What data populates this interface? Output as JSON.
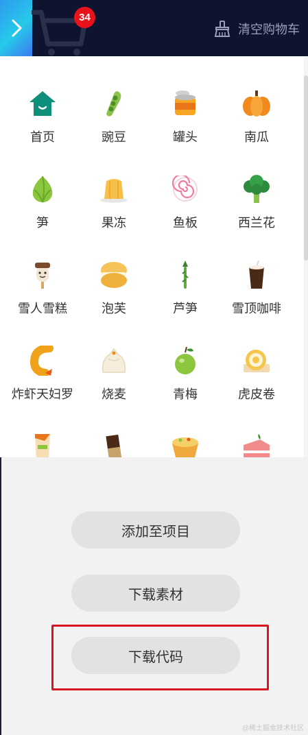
{
  "header": {
    "cart_count": "34",
    "clear_cart_label": "清空购物车"
  },
  "products": [
    {
      "label": "首页",
      "icon": "home-icon"
    },
    {
      "label": "豌豆",
      "icon": "pea-icon"
    },
    {
      "label": "罐头",
      "icon": "can-icon"
    },
    {
      "label": "南瓜",
      "icon": "pumpkin-icon"
    },
    {
      "label": "笋",
      "icon": "bamboo-shoot-icon"
    },
    {
      "label": "果冻",
      "icon": "jelly-icon"
    },
    {
      "label": "鱼板",
      "icon": "fishcake-icon"
    },
    {
      "label": "西兰花",
      "icon": "broccoli-icon"
    },
    {
      "label": "雪人雪糕",
      "icon": "snowman-icecream-icon"
    },
    {
      "label": "泡芙",
      "icon": "puff-icon"
    },
    {
      "label": "芦笋",
      "icon": "asparagus-icon"
    },
    {
      "label": "雪顶咖啡",
      "icon": "coffee-icon"
    },
    {
      "label": "炸虾天妇罗",
      "icon": "tempura-icon"
    },
    {
      "label": "烧麦",
      "icon": "shaomai-icon"
    },
    {
      "label": "青梅",
      "icon": "plum-icon"
    },
    {
      "label": "虎皮卷",
      "icon": "swiss-roll-icon"
    },
    {
      "label": "",
      "icon": "wrap-icon"
    },
    {
      "label": "",
      "icon": "chocolate-icon"
    },
    {
      "label": "",
      "icon": "tart-icon"
    },
    {
      "label": "",
      "icon": "cake-icon"
    }
  ],
  "actions": {
    "add_to_project": "添加至项目",
    "download_assets": "下载素材",
    "download_code": "下载代码"
  },
  "watermark": "@稀土掘金技术社区",
  "colors": {
    "header_bg": "#0e1330",
    "badge": "#e8131a",
    "highlight_border": "#d8151e"
  }
}
